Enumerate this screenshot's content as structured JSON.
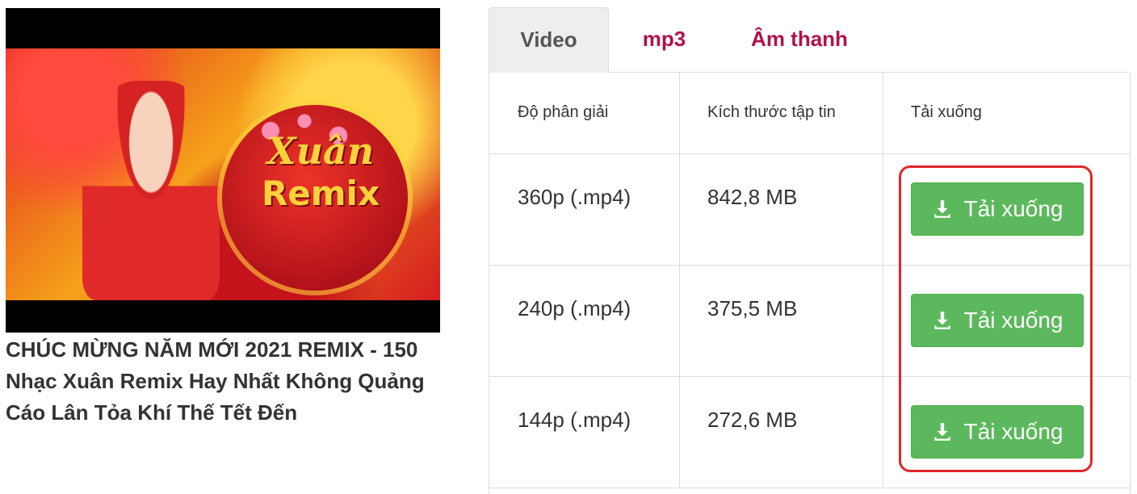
{
  "video": {
    "thumbnail": {
      "title_art_line1": "Xuân",
      "title_art_line2": "Remix"
    },
    "title": "CHÚC MỪNG NĂM MỚI 2021 REMIX - 150 Nhạc Xuân Remix Hay Nhất Không Quảng Cáo Lân Tỏa Khí Thế Tết Đến"
  },
  "tabs": [
    {
      "label": "Video",
      "active": true
    },
    {
      "label": "mp3",
      "active": false
    },
    {
      "label": "Âm thanh",
      "active": false
    }
  ],
  "table": {
    "headers": [
      "Độ phân giải",
      "Kích thước tập tin",
      "Tải xuống"
    ],
    "rows": [
      {
        "resolution": "360p (.mp4)",
        "size": "842,8 MB",
        "button": "Tải xuống"
      },
      {
        "resolution": "240p (.mp4)",
        "size": "375,5 MB",
        "button": "Tải xuống"
      },
      {
        "resolution": "144p (.mp4)",
        "size": "272,6 MB",
        "button": "Tải xuống"
      }
    ]
  },
  "colors": {
    "tab_link": "#b0124a",
    "button_bg": "#5cb85c",
    "highlight": "#e0262b"
  }
}
